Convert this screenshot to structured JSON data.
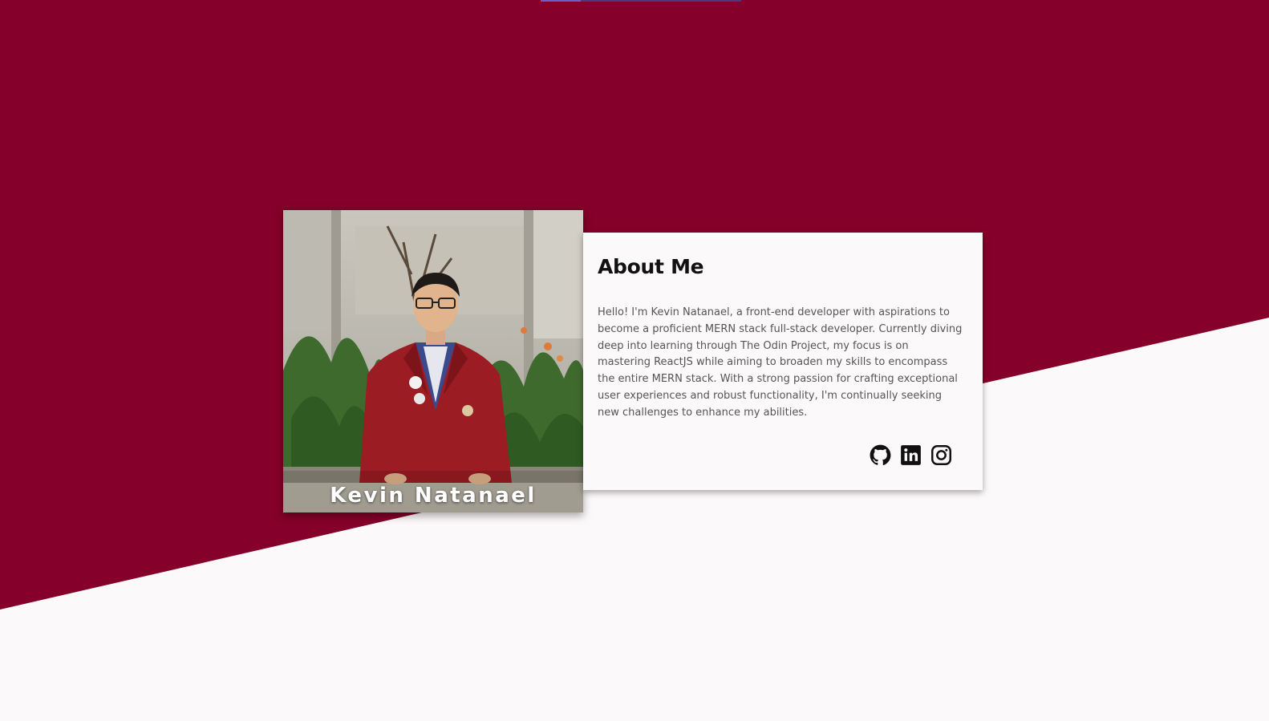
{
  "colors": {
    "primary": "#85002a",
    "background": "#fcf9fa",
    "card": "#fcf9fa",
    "text_dark": "#111111",
    "text_body": "#555555"
  },
  "profile": {
    "photo_caption": "Kevin Natanael"
  },
  "about": {
    "title": "About Me",
    "description": "Hello! I'm Kevin Natanael, a front-end developer with aspirations to become a proficient MERN stack full-stack developer. Currently diving deep into learning through The Odin Project, my focus is on mastering ReactJS while aiming to broaden my skills to encompass the entire MERN stack. With a strong passion for crafting exceptional user experiences and robust functionality, I'm continually seeking new challenges to enhance my abilities."
  },
  "socials": [
    {
      "icon": "github-icon"
    },
    {
      "icon": "linkedin-icon"
    },
    {
      "icon": "instagram-icon"
    }
  ]
}
